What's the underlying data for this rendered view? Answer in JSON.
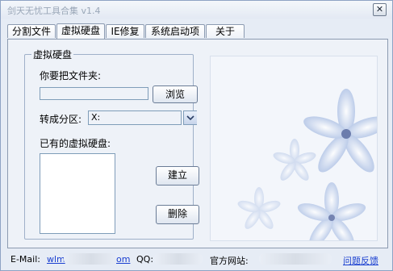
{
  "window": {
    "title": "剑天无忧工具合集 v1.4",
    "close_glyph": "✕"
  },
  "tabs": [
    {
      "label": "分割文件",
      "active": false
    },
    {
      "label": "虚拟硬盘",
      "active": true
    },
    {
      "label": "IE修复",
      "active": false
    },
    {
      "label": "系统启动项",
      "active": false
    },
    {
      "label": "关于",
      "active": false
    }
  ],
  "virtual_disk": {
    "group_title": "虚拟硬盘",
    "folder_label": "你要把文件夹:",
    "folder_value": "",
    "browse_button": "浏览",
    "partition_label": "转成分区:",
    "partition_selected": "X:",
    "existing_label": "已有的虚拟硬盘:",
    "existing_items": [],
    "create_button": "建立",
    "delete_button": "删除"
  },
  "statusbar": {
    "email_label": "E-Mail:",
    "email_value_prefix": "wlm",
    "email_value_suffix": "om",
    "qq_label": "QQ:",
    "site_label": "官方网站:",
    "feedback_link": "问题反馈"
  },
  "colors": {
    "accent_link": "#1a3fd0",
    "flower": "#8ea7d6",
    "window_border": "#8ea3c4"
  }
}
